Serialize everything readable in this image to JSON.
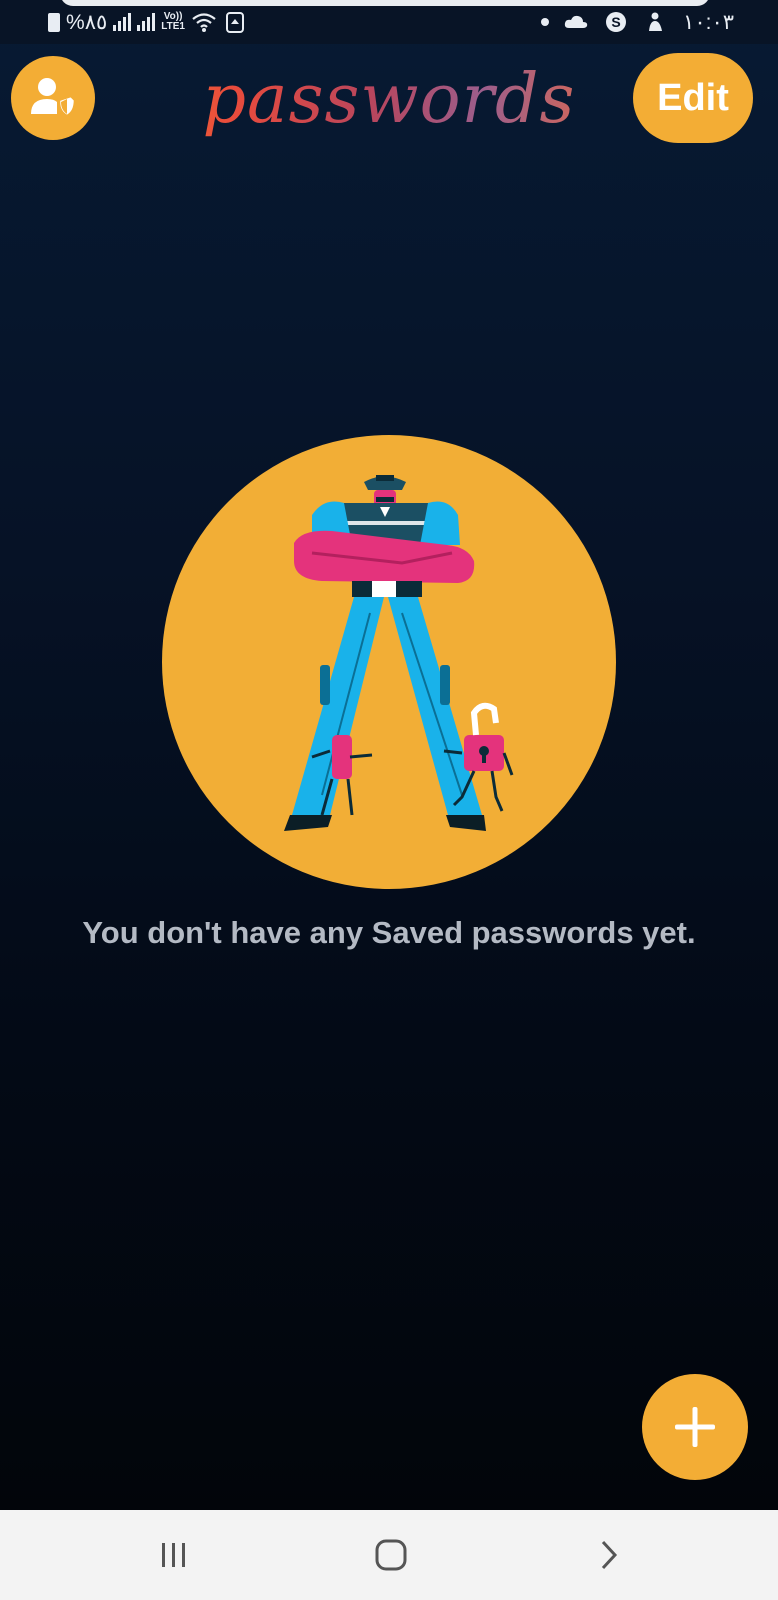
{
  "status_bar": {
    "battery_text": "%٨٥",
    "network_volte": "Vo))",
    "network_lte": "LTE1",
    "time": "١٠:٠٣"
  },
  "header": {
    "title": "passwords",
    "edit_label": "Edit",
    "account_icon": "user-shield-icon"
  },
  "main": {
    "empty_message": "You don't have any Saved passwords yet.",
    "illustration": "security-guard-with-locks"
  },
  "fab": {
    "icon": "plus-icon"
  },
  "nav": {
    "recents_icon": "recents-icon",
    "home_icon": "home-icon",
    "back_icon": "back-icon"
  },
  "colors": {
    "accent": "#f3ad35",
    "background_top": "#071a33",
    "background_bottom": "#020408",
    "text_muted": "#b4bac4"
  }
}
